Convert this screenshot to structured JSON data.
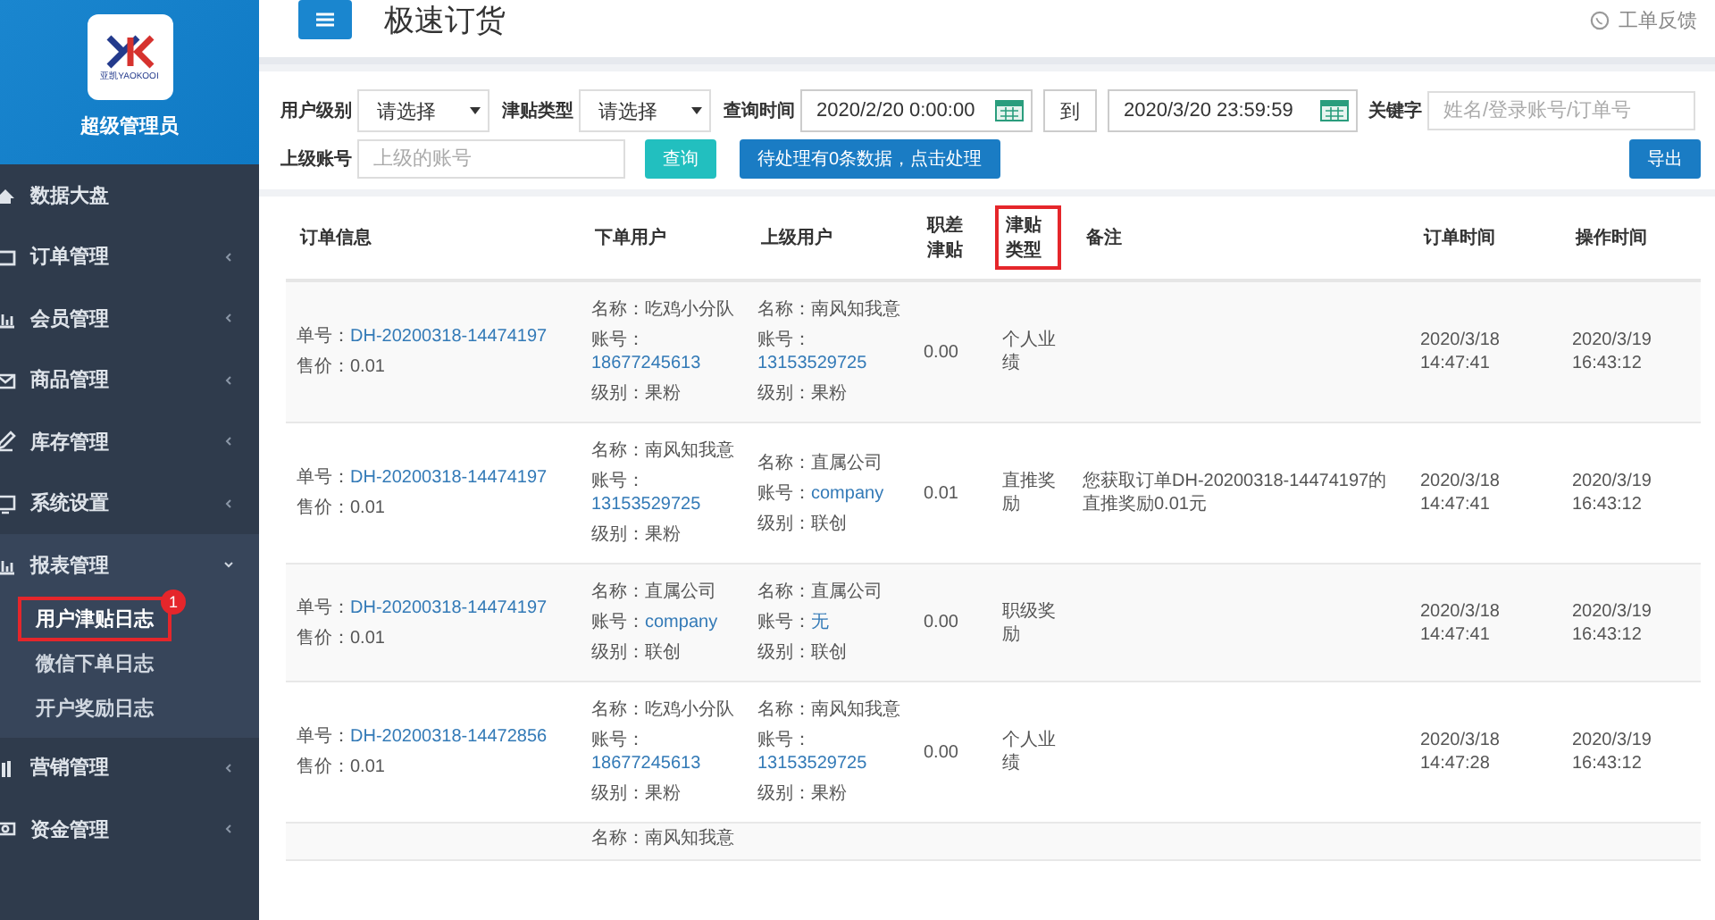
{
  "sidebar": {
    "logo_text": "亚凯YAOKOOI",
    "user_role": "超级管理员",
    "items": [
      {
        "label": "数据大盘",
        "has_caret": false,
        "expanded": false
      },
      {
        "label": "订单管理",
        "has_caret": true,
        "expanded": false
      },
      {
        "label": "会员管理",
        "has_caret": true,
        "expanded": false
      },
      {
        "label": "商品管理",
        "has_caret": true,
        "expanded": false
      },
      {
        "label": "库存管理",
        "has_caret": true,
        "expanded": false
      },
      {
        "label": "系统设置",
        "has_caret": true,
        "expanded": false
      },
      {
        "label": "报表管理",
        "has_caret": true,
        "expanded": true,
        "children": [
          {
            "label": "用户津贴日志",
            "highlighted": true,
            "badge": "1"
          },
          {
            "label": "微信下单日志",
            "highlighted": false
          },
          {
            "label": "开户奖励日志",
            "highlighted": false
          }
        ]
      },
      {
        "label": "营销管理",
        "has_caret": true,
        "expanded": false
      },
      {
        "label": "资金管理",
        "has_caret": true,
        "expanded": false
      }
    ]
  },
  "header": {
    "title": "极速订货",
    "feedback": "工单反馈"
  },
  "filters": {
    "user_level": {
      "label": "用户级别",
      "placeholder": "请选择"
    },
    "allowance_type": {
      "label": "津贴类型",
      "placeholder": "请选择"
    },
    "query_time": {
      "label": "查询时间",
      "from": "2020/2/20 0:00:00",
      "to_label": "到",
      "to": "2020/3/20 23:59:59"
    },
    "keyword": {
      "label": "关键字",
      "placeholder": "姓名/登录账号/订单号"
    },
    "parent_account": {
      "label": "上级账号",
      "placeholder": "上级的账号"
    },
    "search_button": "查询",
    "pending_button": "待处理有0条数据，点击处理",
    "export_button": "导出"
  },
  "table": {
    "columns": [
      {
        "label": "订单信息",
        "highlighted": false
      },
      {
        "label": "下单用户",
        "highlighted": false
      },
      {
        "label": "上级用户",
        "highlighted": false
      },
      {
        "label": "职差津贴",
        "highlighted": false
      },
      {
        "label": "津贴类型",
        "highlighted": true
      },
      {
        "label": "备注",
        "highlighted": false
      },
      {
        "label": "订单时间",
        "highlighted": false
      },
      {
        "label": "操作时间",
        "highlighted": false
      }
    ],
    "rows": [
      {
        "order_no_label": "单号：",
        "order_no": "DH-20200318-14474197",
        "price": "售价：0.01",
        "user": {
          "name": "名称：吃鸡小分队",
          "account_label": "账号：",
          "account": "18677245613",
          "level": "级别：果粉"
        },
        "parent": {
          "name": "名称：南风知我意",
          "account_label": "账号：",
          "account": "13153529725",
          "level": "级别：果粉"
        },
        "allowance": "0.00",
        "type": "个人业绩",
        "note": "",
        "order_time": "2020/3/18 14:47:41",
        "op_time": "2020/3/19 16:43:12"
      },
      {
        "order_no_label": "单号：",
        "order_no": "DH-20200318-14474197",
        "price": "售价：0.01",
        "user": {
          "name": "名称：南风知我意",
          "account_label": "账号：",
          "account": "13153529725",
          "level": "级别：果粉"
        },
        "parent": {
          "name": "名称：直属公司",
          "account_label": "账号：",
          "account": "company",
          "level": "级别：联创"
        },
        "allowance": "0.01",
        "type": "直推奖励",
        "note": "您获取订单DH-20200318-14474197的直推奖励0.01元",
        "order_time": "2020/3/18 14:47:41",
        "op_time": "2020/3/19 16:43:12"
      },
      {
        "order_no_label": "单号：",
        "order_no": "DH-20200318-14474197",
        "price": "售价：0.01",
        "user": {
          "name": "名称：直属公司",
          "account_label": "账号：",
          "account": "company",
          "level": "级别：联创"
        },
        "parent": {
          "name": "名称：直属公司",
          "account_label": "账号：",
          "account": "无",
          "level": "级别：联创"
        },
        "allowance": "0.00",
        "type": "职级奖励",
        "note": "",
        "order_time": "2020/3/18 14:47:41",
        "op_time": "2020/3/19 16:43:12"
      },
      {
        "order_no_label": "单号：",
        "order_no": "DH-20200318-14472856",
        "price": "售价：0.01",
        "user": {
          "name": "名称：吃鸡小分队",
          "account_label": "账号：",
          "account": "18677245613",
          "level": "级别：果粉"
        },
        "parent": {
          "name": "名称：南风知我意",
          "account_label": "账号：",
          "account": "13153529725",
          "level": "级别：果粉"
        },
        "allowance": "0.00",
        "type": "个人业绩",
        "note": "",
        "order_time": "2020/3/18 14:47:28",
        "op_time": "2020/3/19 16:43:12"
      }
    ],
    "partial_row": {
      "user_name": "名称：南风知我意"
    }
  }
}
